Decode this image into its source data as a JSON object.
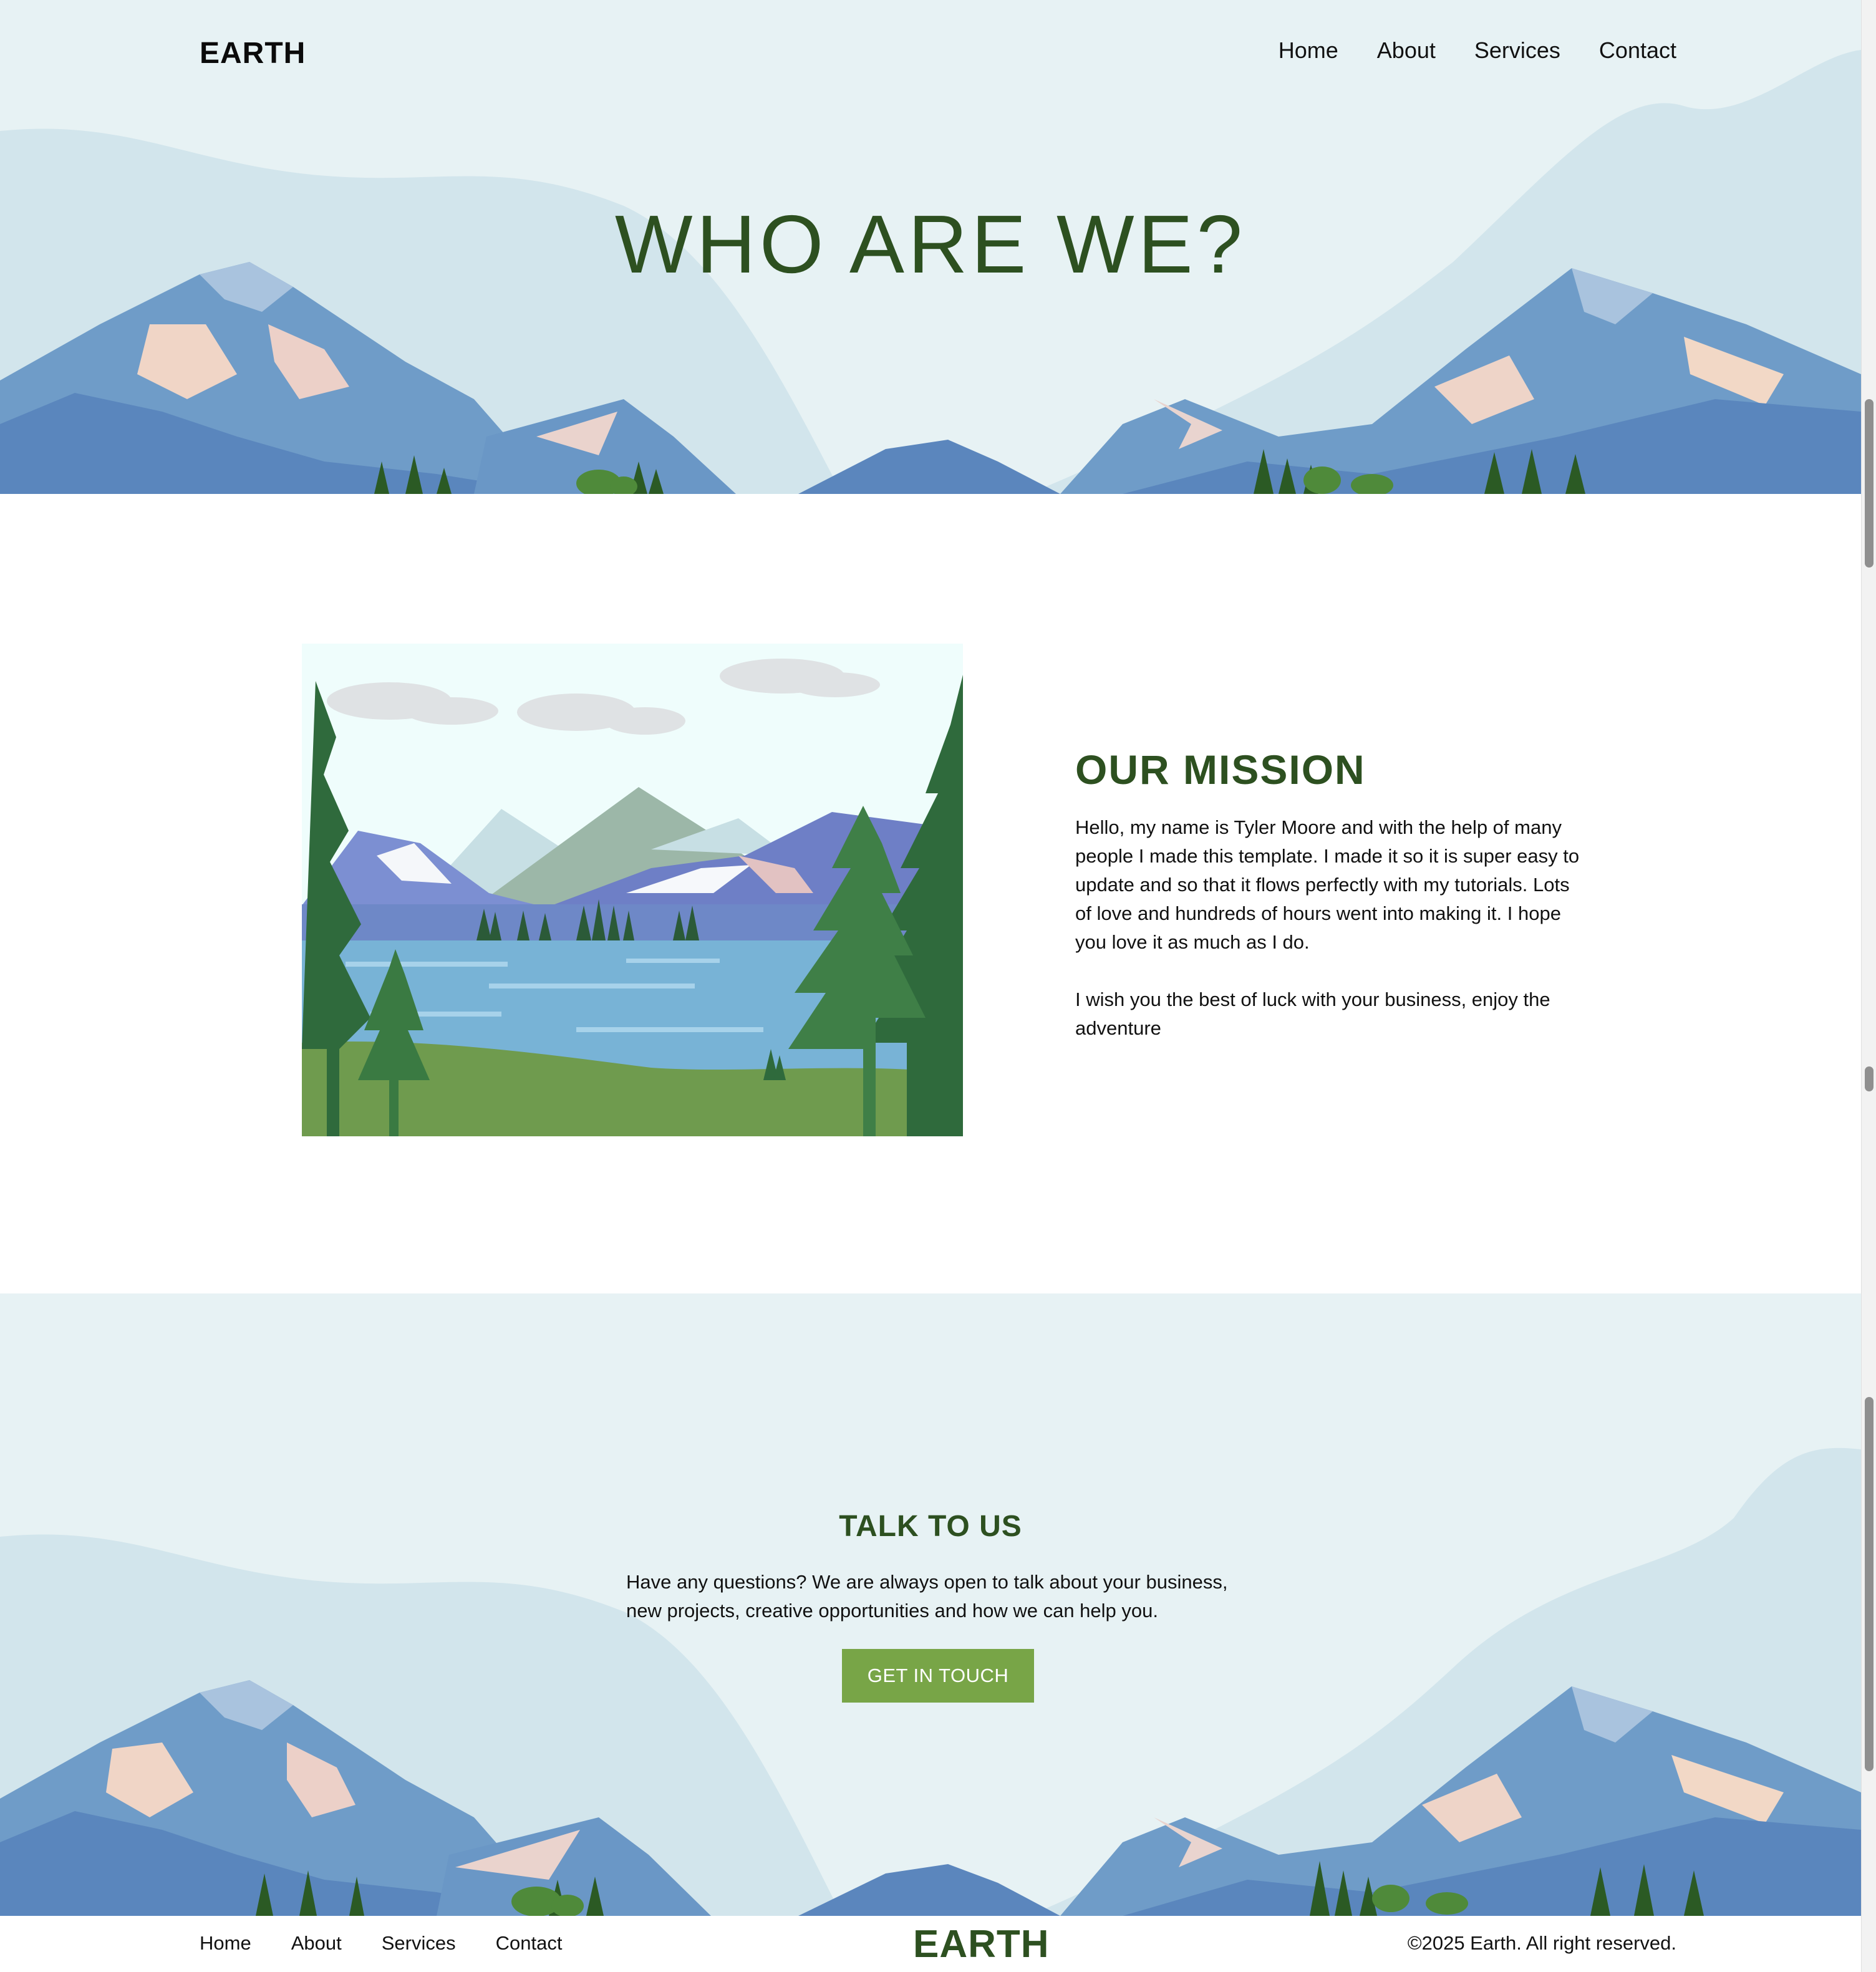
{
  "header": {
    "logo": "EARTH",
    "nav": [
      "Home",
      "About",
      "Services",
      "Contact"
    ]
  },
  "hero": {
    "title": "WHO ARE WE?"
  },
  "mission": {
    "title": "OUR MISSION",
    "paragraph1": "Hello, my name is Tyler Moore and with the help of many people I made this template. I made it so it is super easy to update and so that it flows perfectly with my tutorials. Lots of love and hundreds of hours went into making it. I hope you love it as much as I do.",
    "paragraph2": "I wish you the best of luck with your business, enjoy the adventure"
  },
  "cta": {
    "title": "TALK TO US",
    "text": "Have any questions? We are always open to talk about your business, new projects, creative opportunities and how we can help you.",
    "button": "GET IN TOUCH"
  },
  "footer": {
    "nav": [
      "Home",
      "About",
      "Services",
      "Contact"
    ],
    "logo": "EARTH",
    "copyright": "©2025 Earth. All right reserved."
  },
  "colors": {
    "brand_green": "#2d5020",
    "button_green": "#78a547",
    "sky": "#e7f2f4",
    "mountain_blue": "#5b86bd",
    "snow": "#e9d5d0"
  },
  "icons": [
    "mountain-landscape-illustration",
    "lake-landscape-illustration"
  ]
}
